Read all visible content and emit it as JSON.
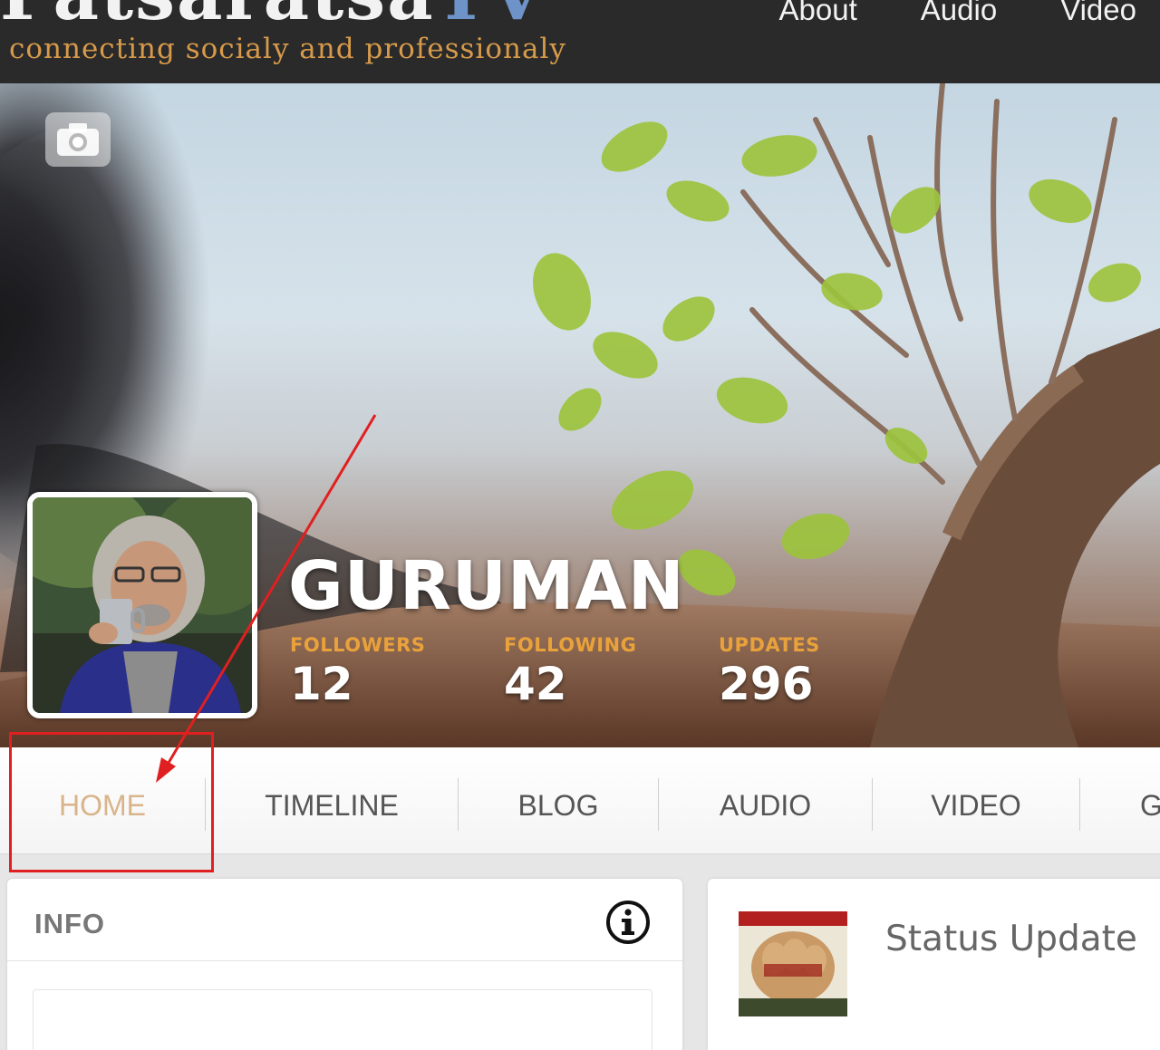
{
  "header": {
    "logo_text": "Patsaratsa",
    "logo_suffix": "TV",
    "tagline": "connecting socialy and professionaly",
    "nav": [
      {
        "label": "About"
      },
      {
        "label": "Audio"
      },
      {
        "label": "Video"
      }
    ]
  },
  "profile": {
    "username": "GURUMAN",
    "stats": {
      "followers": {
        "label": "FOLLOWERS",
        "value": "12"
      },
      "following": {
        "label": "FOLLOWING",
        "value": "42"
      },
      "updates": {
        "label": "UPDATES",
        "value": "296"
      }
    }
  },
  "tabs": [
    {
      "label": "HOME",
      "active": true
    },
    {
      "label": "TIMELINE"
    },
    {
      "label": "BLOG"
    },
    {
      "label": "AUDIO"
    },
    {
      "label": "VIDEO"
    },
    {
      "label": "G"
    }
  ],
  "info": {
    "title": "INFO"
  },
  "status": {
    "title": "Status Update"
  },
  "colors": {
    "header_bg": "#2a2a2a",
    "tagline": "#d79a4a",
    "stat_label": "#e9a23b",
    "active_tab": "#d9b48a",
    "annotation": "#e02020"
  }
}
